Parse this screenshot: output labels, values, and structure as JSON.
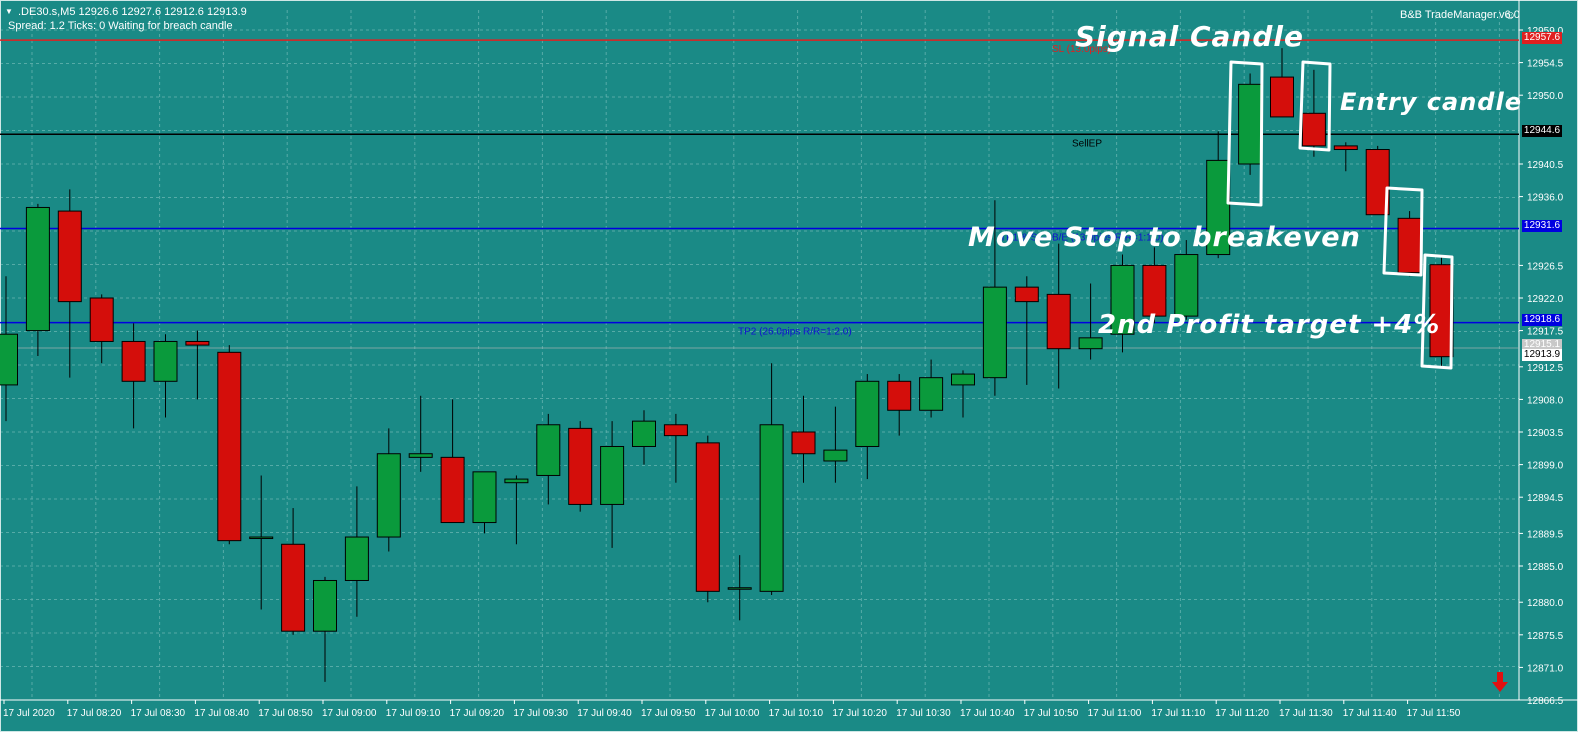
{
  "header": {
    "dropdown_glyph": "▼",
    "symbol_line": ".DE30.s,M5  12926.6 12927.6 12912.6 12913.9",
    "status_line": "Spread: 1.2  Ticks: 0  Waiting for breach candle",
    "plugin_name": "B&B TradeManager.v6.0",
    "plugin_icon": "smiley-icon"
  },
  "price_axis": {
    "labels": [
      "12959.0",
      "12954.5",
      "12950.0",
      "12940.5",
      "12936.0",
      "12926.5",
      "12922.0",
      "12917.5",
      "12912.5",
      "12908.0",
      "12903.5",
      "12899.0",
      "12894.5",
      "12889.5",
      "12885.0",
      "12880.0",
      "12875.5",
      "12871.0",
      "12866.5"
    ],
    "sl_tag": "12957.6",
    "sellep_tag": "12944.6",
    "tp1_tag": "12931.6",
    "tp2_tag": "12918.6",
    "last_tag": "12913.9",
    "bid_tag": "12915.1"
  },
  "time_axis": {
    "labels": [
      "17 Jul 2020",
      "17 Jul 08:20",
      "17 Jul 08:30",
      "17 Jul 08:40",
      "17 Jul 08:50",
      "17 Jul 09:00",
      "17 Jul 09:10",
      "17 Jul 09:20",
      "17 Jul 09:30",
      "17 Jul 09:40",
      "17 Jul 09:50",
      "17 Jul 10:00",
      "17 Jul 10:10",
      "17 Jul 10:20",
      "17 Jul 10:30",
      "17 Jul 10:40",
      "17 Jul 10:50",
      "17 Jul 11:00",
      "17 Jul 11:10",
      "17 Jul 11:20",
      "17 Jul 11:30",
      "17 Jul 11:40",
      "17 Jul 11:50"
    ]
  },
  "lines": {
    "sl_label": "SL (13.0pips)",
    "sellep_label": "SellEP",
    "tp1_label": "TP1 & SL->B/E (13.0pips R/R=1:1.0)",
    "tp2_label": "TP2 (26.0pips R/R=1:2.0)"
  },
  "annotations": {
    "signal": "Signal Candle",
    "entry": "Entry candle",
    "breakeven": "Move Stop to breakeven",
    "target2": "2nd Profit target +4%"
  },
  "colors": {
    "background": "#1a8a86",
    "grid": "#6bb7b3",
    "bull": "#0a9a3c",
    "bear": "#d40e0b",
    "sl_line": "#e02020",
    "sellep_line": "#000000",
    "tp_line": "#0000e0",
    "axis_bg": "#1a8a86"
  },
  "chart_data": {
    "type": "candlestick",
    "symbol": ".DE30.s",
    "timeframe": "M5",
    "ylim": [
      12865.0,
      12961.0
    ],
    "levels": {
      "sl": 12957.6,
      "sell_entry": 12944.6,
      "tp1": 12931.6,
      "tp2": 12918.6,
      "last": 12913.9,
      "bid": 12915.1
    },
    "candles": [
      {
        "o": 12910.0,
        "h": 12925.0,
        "l": 12905.0,
        "c": 12917.0
      },
      {
        "o": 12917.5,
        "h": 12935.0,
        "l": 12914.0,
        "c": 12934.5
      },
      {
        "o": 12934.0,
        "h": 12937.0,
        "l": 12911.0,
        "c": 12921.5
      },
      {
        "o": 12922.0,
        "h": 12922.5,
        "l": 12913.0,
        "c": 12916.0
      },
      {
        "o": 12916.0,
        "h": 12918.5,
        "l": 12904.0,
        "c": 12910.5
      },
      {
        "o": 12910.5,
        "h": 12917.0,
        "l": 12905.5,
        "c": 12916.0
      },
      {
        "o": 12916.0,
        "h": 12917.5,
        "l": 12908.0,
        "c": 12915.5
      },
      {
        "o": 12914.5,
        "h": 12915.5,
        "l": 12888.0,
        "c": 12888.5
      },
      {
        "o": 12889.0,
        "h": 12897.5,
        "l": 12879.0,
        "c": 12889.0
      },
      {
        "o": 12888.0,
        "h": 12893.0,
        "l": 12875.5,
        "c": 12876.0
      },
      {
        "o": 12876.0,
        "h": 12883.5,
        "l": 12869.0,
        "c": 12883.0
      },
      {
        "o": 12883.0,
        "h": 12896.0,
        "l": 12878.0,
        "c": 12889.0
      },
      {
        "o": 12889.0,
        "h": 12904.0,
        "l": 12887.0,
        "c": 12900.5
      },
      {
        "o": 12900.0,
        "h": 12908.5,
        "l": 12898.0,
        "c": 12900.5
      },
      {
        "o": 12900.0,
        "h": 12908.0,
        "l": 12893.5,
        "c": 12891.0
      },
      {
        "o": 12891.0,
        "h": 12898.0,
        "l": 12889.5,
        "c": 12898.0
      },
      {
        "o": 12896.5,
        "h": 12897.5,
        "l": 12888.0,
        "c": 12897.0
      },
      {
        "o": 12897.5,
        "h": 12906.0,
        "l": 12893.5,
        "c": 12904.5
      },
      {
        "o": 12904.0,
        "h": 12905.0,
        "l": 12892.5,
        "c": 12893.5
      },
      {
        "o": 12893.5,
        "h": 12905.0,
        "l": 12887.5,
        "c": 12901.5
      },
      {
        "o": 12901.5,
        "h": 12906.5,
        "l": 12899.0,
        "c": 12905.0
      },
      {
        "o": 12904.5,
        "h": 12906.0,
        "l": 12896.5,
        "c": 12903.0
      },
      {
        "o": 12902.0,
        "h": 12903.0,
        "l": 12880.0,
        "c": 12881.5
      },
      {
        "o": 12882.0,
        "h": 12886.5,
        "l": 12877.5,
        "c": 12882.0
      },
      {
        "o": 12881.5,
        "h": 12913.0,
        "l": 12881.0,
        "c": 12904.5
      },
      {
        "o": 12903.5,
        "h": 12908.5,
        "l": 12896.5,
        "c": 12900.5
      },
      {
        "o": 12899.5,
        "h": 12907.0,
        "l": 12896.5,
        "c": 12901.0
      },
      {
        "o": 12901.5,
        "h": 12911.5,
        "l": 12897.0,
        "c": 12910.5
      },
      {
        "o": 12910.5,
        "h": 12911.5,
        "l": 12903.0,
        "c": 12906.5
      },
      {
        "o": 12906.5,
        "h": 12913.5,
        "l": 12905.5,
        "c": 12911.0
      },
      {
        "o": 12910.0,
        "h": 12912.0,
        "l": 12905.5,
        "c": 12911.5
      },
      {
        "o": 12911.0,
        "h": 12935.5,
        "l": 12908.5,
        "c": 12923.5
      },
      {
        "o": 12923.5,
        "h": 12925.0,
        "l": 12910.0,
        "c": 12921.5
      },
      {
        "o": 12922.5,
        "h": 12929.5,
        "l": 12909.5,
        "c": 12915.0
      },
      {
        "o": 12915.0,
        "h": 12924.0,
        "l": 12913.5,
        "c": 12916.5
      },
      {
        "o": 12917.0,
        "h": 12928.0,
        "l": 12914.5,
        "c": 12926.5
      },
      {
        "o": 12926.5,
        "h": 12929.0,
        "l": 12918.5,
        "c": 12919.5
      },
      {
        "o": 12919.5,
        "h": 12930.0,
        "l": 12919.0,
        "c": 12928.0
      },
      {
        "o": 12928.0,
        "h": 12945.0,
        "l": 12927.5,
        "c": 12941.0
      },
      {
        "o": 12940.5,
        "h": 12953.0,
        "l": 12939.0,
        "c": 12951.5
      },
      {
        "o": 12952.5,
        "h": 12956.5,
        "l": 12947.5,
        "c": 12947.0
      },
      {
        "o": 12947.5,
        "h": 12953.5,
        "l": 12941.5,
        "c": 12943.0
      },
      {
        "o": 12943.0,
        "h": 12943.5,
        "l": 12939.5,
        "c": 12942.5
      },
      {
        "o": 12942.5,
        "h": 12943.0,
        "l": 12934.5,
        "c": 12933.5
      },
      {
        "o": 12933.0,
        "h": 12934.0,
        "l": 12925.0,
        "c": 12925.5
      },
      {
        "o": 12926.6,
        "h": 12927.6,
        "l": 12912.6,
        "c": 12913.9
      }
    ]
  }
}
